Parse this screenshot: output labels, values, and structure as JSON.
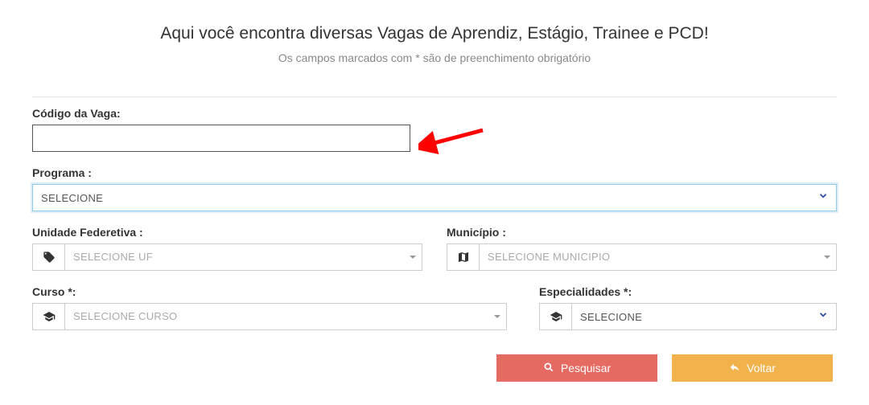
{
  "header": {
    "title": "Aqui você encontra diversas Vagas de Aprendiz, Estágio, Trainee e PCD!",
    "subtitle": "Os campos marcados com * são de preenchimento obrigatório"
  },
  "fields": {
    "codigo": {
      "label": "Código da Vaga:",
      "value": ""
    },
    "programa": {
      "label": "Programa :",
      "selected": "SELECIONE"
    },
    "uf": {
      "label": "Unidade Federetiva :",
      "selected": "SELECIONE UF"
    },
    "municipio": {
      "label": "Município :",
      "selected": "SELECIONE MUNICIPIO"
    },
    "curso": {
      "label": "Curso *:",
      "selected": "SELECIONE CURSO"
    },
    "especialidades": {
      "label": "Especialidades *:",
      "selected": "SELECIONE"
    }
  },
  "actions": {
    "search": "Pesquisar",
    "back": "Voltar"
  }
}
